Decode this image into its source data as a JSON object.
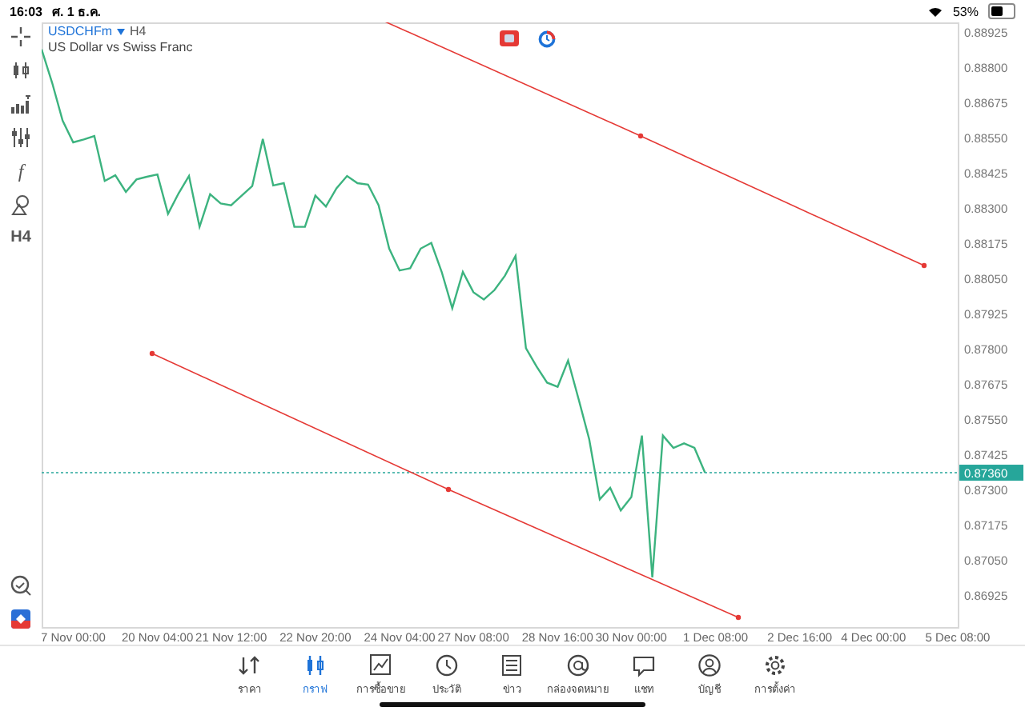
{
  "status_bar": {
    "time": "16:03",
    "date": "ศ. 1 ธ.ค.",
    "battery": "53%"
  },
  "toolbar": {
    "items": [
      {
        "kind": "crosshair"
      },
      {
        "kind": "candles"
      },
      {
        "kind": "indicators"
      },
      {
        "kind": "sliders"
      },
      {
        "kind": "function",
        "label": "f"
      },
      {
        "kind": "shapes"
      },
      {
        "kind": "text",
        "label": "H4"
      }
    ],
    "bottom_items": [
      {
        "kind": "chart-search"
      },
      {
        "kind": "logo"
      }
    ]
  },
  "chart": {
    "symbol": "USDCHFm",
    "timeframe": "H4",
    "description": "US Dollar vs Swiss Franc",
    "chart_data": {
      "type": "line",
      "categories": [
        null,
        null,
        null,
        "7 Nov 00:00",
        null,
        null,
        null,
        null,
        null,
        null,
        null,
        "20 Nov 04:00",
        null,
        null,
        null,
        null,
        null,
        null,
        "21 Nov 12:00",
        null,
        null,
        null,
        null,
        null,
        null,
        null,
        "22 Nov 20:00",
        null,
        null,
        null,
        null,
        null,
        null,
        null,
        "24 Nov 04:00",
        null,
        null,
        null,
        null,
        null,
        null,
        "27 Nov 08:00",
        null,
        null,
        null,
        null,
        null,
        null,
        null,
        "28 Nov 16:00",
        null,
        null,
        null,
        null,
        null,
        null,
        "30 Nov 00:00",
        null,
        null,
        null,
        null,
        null,
        null,
        null,
        "1 Dec 08:00",
        null,
        null,
        null,
        null,
        null,
        null,
        null,
        "2 Dec 16:00",
        null,
        null,
        null,
        null,
        null,
        null,
        "4 Dec 00:00",
        null,
        null,
        null,
        null,
        null,
        null,
        null,
        "5 Dec 08:00"
      ],
      "series": [
        {
          "color": "#3cb37f",
          "values": [
            0.88863,
            0.88744,
            0.8861,
            0.88533,
            0.88543,
            0.88556,
            0.88396,
            0.88416,
            0.88357,
            0.88401,
            0.88411,
            0.88419,
            0.88279,
            0.88352,
            0.88414,
            0.88233,
            0.88349,
            0.88316,
            0.8831,
            0.88344,
            0.88378,
            0.88545,
            0.8838,
            0.88388,
            0.88233,
            0.88233,
            0.88344,
            0.88305,
            0.8837,
            0.88414,
            0.88388,
            0.88383,
            0.8831,
            0.88156,
            0.88078,
            0.88086,
            0.88156,
            0.88176,
            0.88073,
            0.87944,
            0.88073,
            0.88001,
            0.87975,
            0.88008,
            0.8806,
            0.8813,
            0.87802,
            0.87737,
            0.8768,
            0.87665,
            0.87758,
            0.87621,
            0.87479,
            0.87265,
            0.87306,
            0.87226,
            0.87273,
            0.87492,
            0.86988,
            0.87492,
            0.87448,
            0.87464,
            0.87448,
            0.8736,
            null,
            null,
            null,
            null,
            null,
            null,
            null,
            null,
            null,
            null,
            null,
            null,
            null,
            null,
            null,
            null,
            null,
            null,
            null,
            null,
            null,
            null,
            null,
            null
          ]
        }
      ],
      "ylim": [
        0.86812,
        0.88959
      ],
      "ref_lines": [
        {
          "axis": "y",
          "value": 0.8736,
          "label": "0.87360"
        }
      ],
      "yticks": [
        {
          "value": 0.86925,
          "label": "0.86925"
        },
        {
          "value": 0.8705,
          "label": "0.87050"
        },
        {
          "value": 0.87175,
          "label": "0.87175"
        },
        {
          "value": 0.873,
          "label": "0.87300"
        },
        {
          "value": 0.87425,
          "label": "0.87425"
        },
        {
          "value": 0.8755,
          "label": "0.87550"
        },
        {
          "value": 0.87675,
          "label": "0.87675"
        },
        {
          "value": 0.878,
          "label": "0.87800"
        },
        {
          "value": 0.87925,
          "label": "0.87925"
        },
        {
          "value": 0.8805,
          "label": "0.88050"
        },
        {
          "value": 0.88175,
          "label": "0.88175"
        },
        {
          "value": 0.883,
          "label": "0.88300"
        },
        {
          "value": 0.88425,
          "label": "0.88425"
        },
        {
          "value": 0.8855,
          "label": "0.88550"
        },
        {
          "value": 0.88675,
          "label": "0.88675"
        },
        {
          "value": 0.888,
          "label": "0.88800"
        },
        {
          "value": 0.88925,
          "label": "0.88925"
        }
      ]
    }
  },
  "nav": [
    {
      "label": "ราคา",
      "selected": false
    },
    {
      "label": "กราฟ",
      "selected": true
    },
    {
      "label": "การซื้อขาย",
      "selected": false
    },
    {
      "label": "ประวัติ",
      "selected": false
    },
    {
      "label": "ข่าว",
      "selected": false
    },
    {
      "label": "กล่องจดหมาย",
      "selected": false
    },
    {
      "label": "แชท",
      "selected": false
    },
    {
      "label": "บัญชี",
      "selected": false
    },
    {
      "label": "การตั้งค่า",
      "selected": false
    }
  ]
}
